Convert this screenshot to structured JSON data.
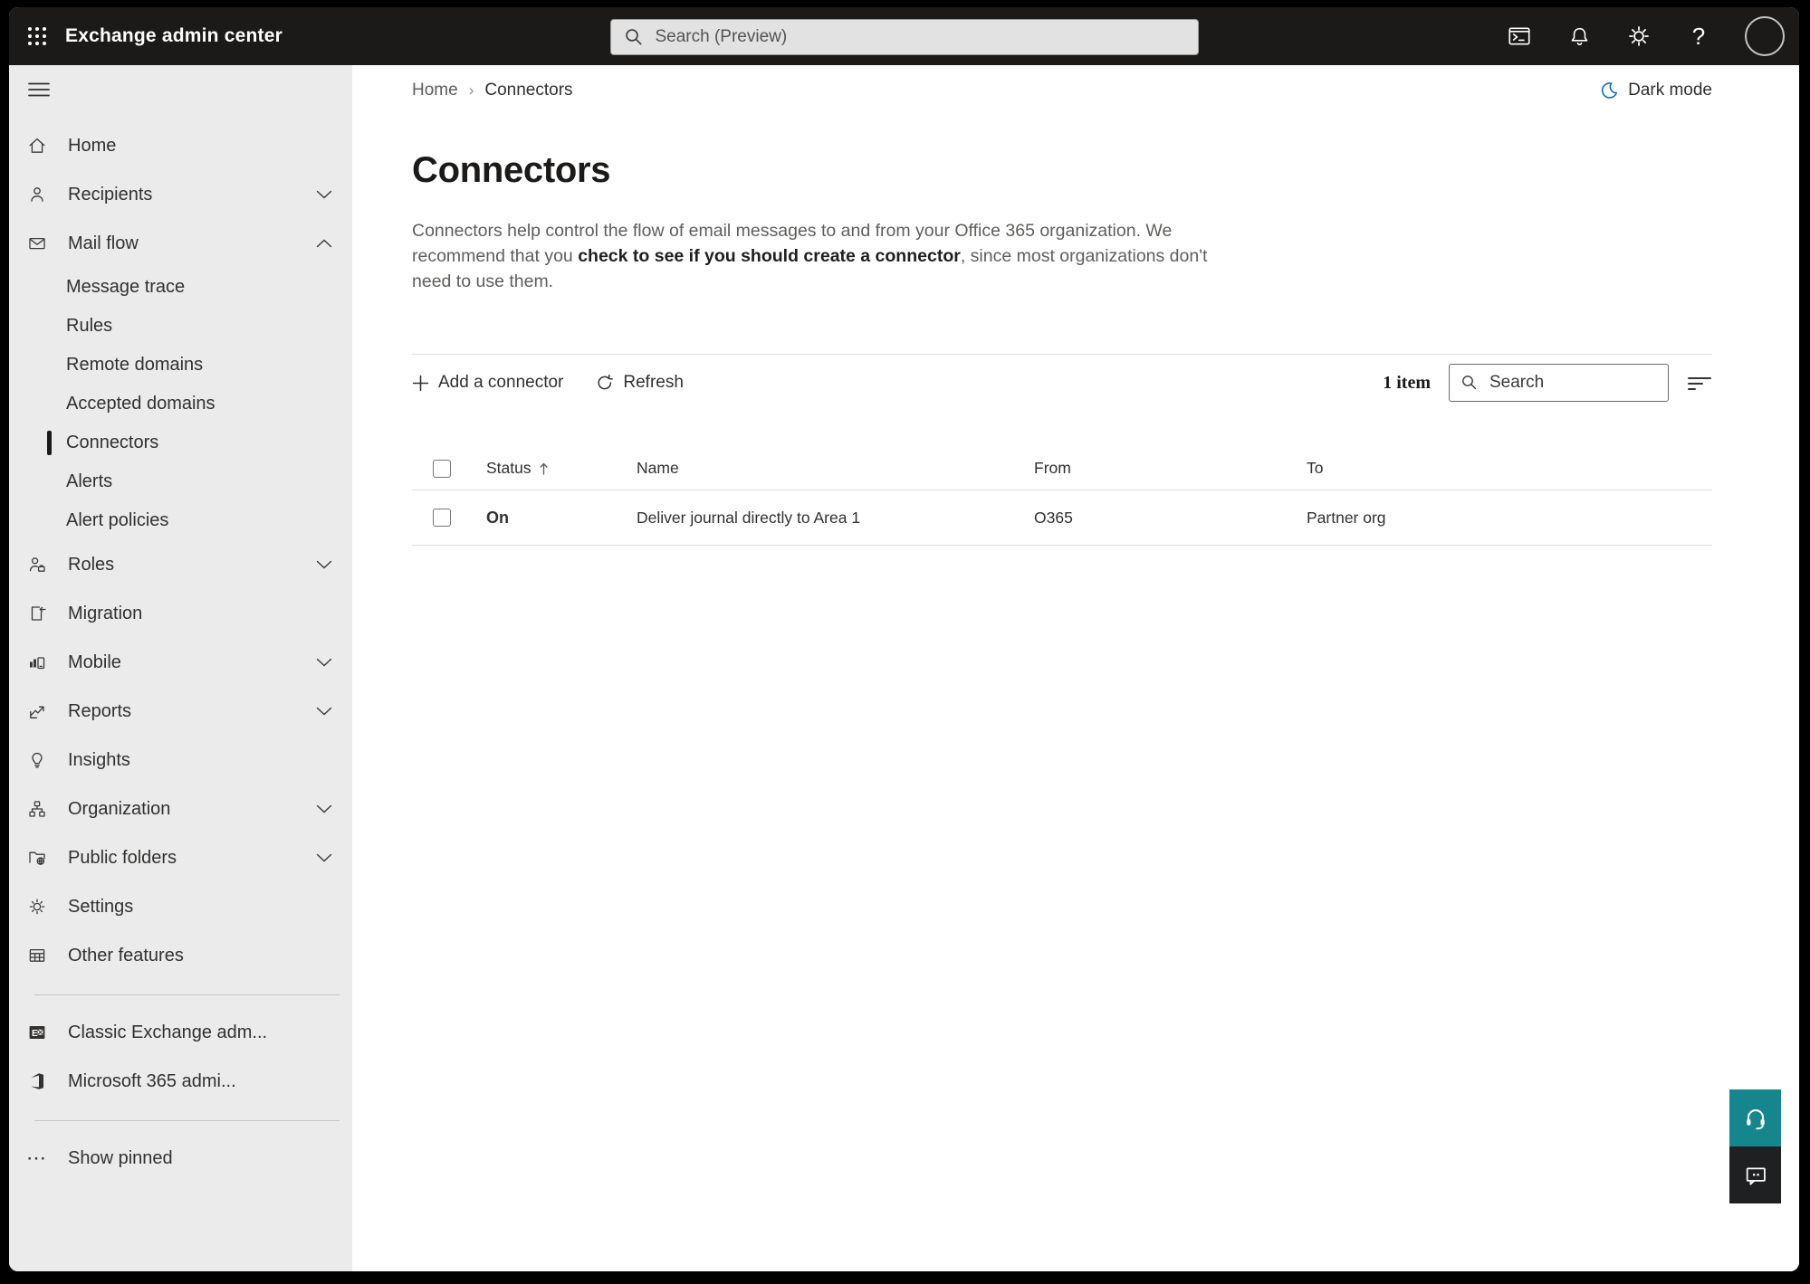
{
  "topbar": {
    "title": "Exchange admin center",
    "search_placeholder": "Search (Preview)"
  },
  "sidebar": {
    "items": [
      {
        "label": "Home"
      },
      {
        "label": "Recipients"
      },
      {
        "label": "Mail flow"
      },
      {
        "label": "Roles"
      },
      {
        "label": "Migration"
      },
      {
        "label": "Mobile"
      },
      {
        "label": "Reports"
      },
      {
        "label": "Insights"
      },
      {
        "label": "Organization"
      },
      {
        "label": "Public folders"
      },
      {
        "label": "Settings"
      },
      {
        "label": "Other features"
      }
    ],
    "mail_flow_children": [
      {
        "label": "Message trace"
      },
      {
        "label": "Rules"
      },
      {
        "label": "Remote domains"
      },
      {
        "label": "Accepted domains"
      },
      {
        "label": "Connectors",
        "selected": true
      },
      {
        "label": "Alerts"
      },
      {
        "label": "Alert policies"
      }
    ],
    "footer": [
      {
        "label": "Classic Exchange adm..."
      },
      {
        "label": "Microsoft 365 admi..."
      }
    ],
    "show_pinned": "Show pinned"
  },
  "breadcrumb": {
    "home": "Home",
    "current": "Connectors"
  },
  "dark_mode_label": "Dark mode",
  "page": {
    "title": "Connectors",
    "description_part1": "Connectors help control the flow of email messages to and from your Office 365 organization. We recommend that you ",
    "description_emphasis": "check to see if you should create a connector",
    "description_part2": ", since most organizations don't need to use them."
  },
  "toolbar": {
    "add_label": "Add a connector",
    "refresh_label": "Refresh",
    "item_count": "1 item",
    "search_placeholder": "Search"
  },
  "table": {
    "headers": {
      "status": "Status",
      "name": "Name",
      "from": "From",
      "to": "To"
    },
    "rows": [
      {
        "status": "On",
        "name": "Deliver journal directly to Area 1",
        "from": "O365",
        "to": "Partner org"
      }
    ]
  },
  "icons": {
    "dark_mode": "moon-icon",
    "help_float": "headset-icon",
    "feedback_float": "speech-bubble-icon"
  },
  "colors": {
    "topbar_bg": "#1b1a19",
    "sidebar_bg": "#ebebeb",
    "accent_blue": "#0f6cbd",
    "help_teal": "#15868e",
    "feedback_dark": "#1f2021",
    "divider": "#e1dfdd",
    "text_primary": "#323130",
    "text_secondary": "#605e5c"
  }
}
